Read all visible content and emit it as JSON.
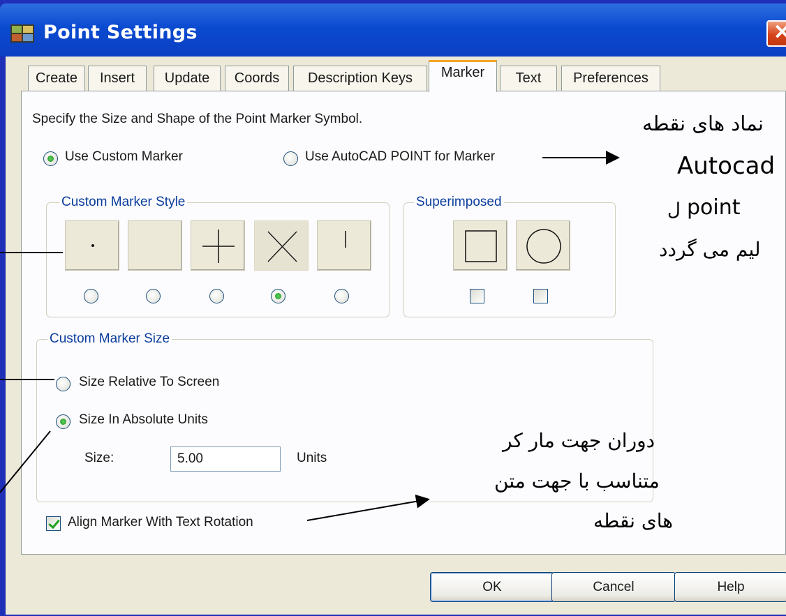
{
  "window": {
    "title": "Point Settings",
    "close_glyph": "✕"
  },
  "tabs": [
    {
      "label": "Create"
    },
    {
      "label": "Insert"
    },
    {
      "label": "Update"
    },
    {
      "label": "Coords"
    },
    {
      "label": "Description Keys"
    },
    {
      "label": "Marker",
      "active": true
    },
    {
      "label": "Text"
    },
    {
      "label": "Preferences"
    }
  ],
  "panel": {
    "instruction": "Specify the Size and Shape of the Point Marker Symbol.",
    "use_custom_marker": {
      "label": "Use Custom Marker",
      "selected": true
    },
    "use_autocad_point": {
      "label": "Use AutoCAD POINT for Marker",
      "selected": false
    },
    "custom_style": {
      "legend": "Custom Marker Style",
      "options": [
        {
          "icon": "dot-marker-icon",
          "selected": false
        },
        {
          "icon": "blank-marker-icon",
          "selected": false
        },
        {
          "icon": "plus-marker-icon",
          "selected": false
        },
        {
          "icon": "x-marker-icon",
          "selected": true
        },
        {
          "icon": "tick-marker-icon",
          "selected": false
        }
      ]
    },
    "superimposed": {
      "legend": "Superimposed",
      "options": [
        {
          "icon": "square-marker-icon",
          "checked": false
        },
        {
          "icon": "circle-marker-icon",
          "checked": false
        }
      ]
    },
    "custom_size": {
      "legend": "Custom Marker Size",
      "relative": {
        "label": "Size Relative To Screen",
        "selected": false
      },
      "absolute": {
        "label": "Size In Absolute Units",
        "selected": true
      },
      "size_label": "Size:",
      "size_value": "5.00",
      "units_label": "Units"
    },
    "align": {
      "label": "Align Marker With Text Rotation",
      "checked": true
    }
  },
  "buttons": {
    "ok": "OK",
    "cancel": "Cancel",
    "help": "Help"
  },
  "annotations": {
    "top_fa_1": "نماد های نقطه",
    "top_en_1": "Autocad",
    "top_en_2": "point",
    "top_fa_frag": "ل",
    "top_fa_3": "ليم می گردد",
    "bottom_fa_1": "دوران جهت مار کر",
    "bottom_fa_2": "متناسب با جهت متن",
    "bottom_fa_3": "های نقطه"
  },
  "colors": {
    "titlebar": "#0a4ad0",
    "background": "#1f2fb8",
    "dialog": "#ece9d8",
    "group_title": "#0b3d9c",
    "close": "#d5441c"
  }
}
